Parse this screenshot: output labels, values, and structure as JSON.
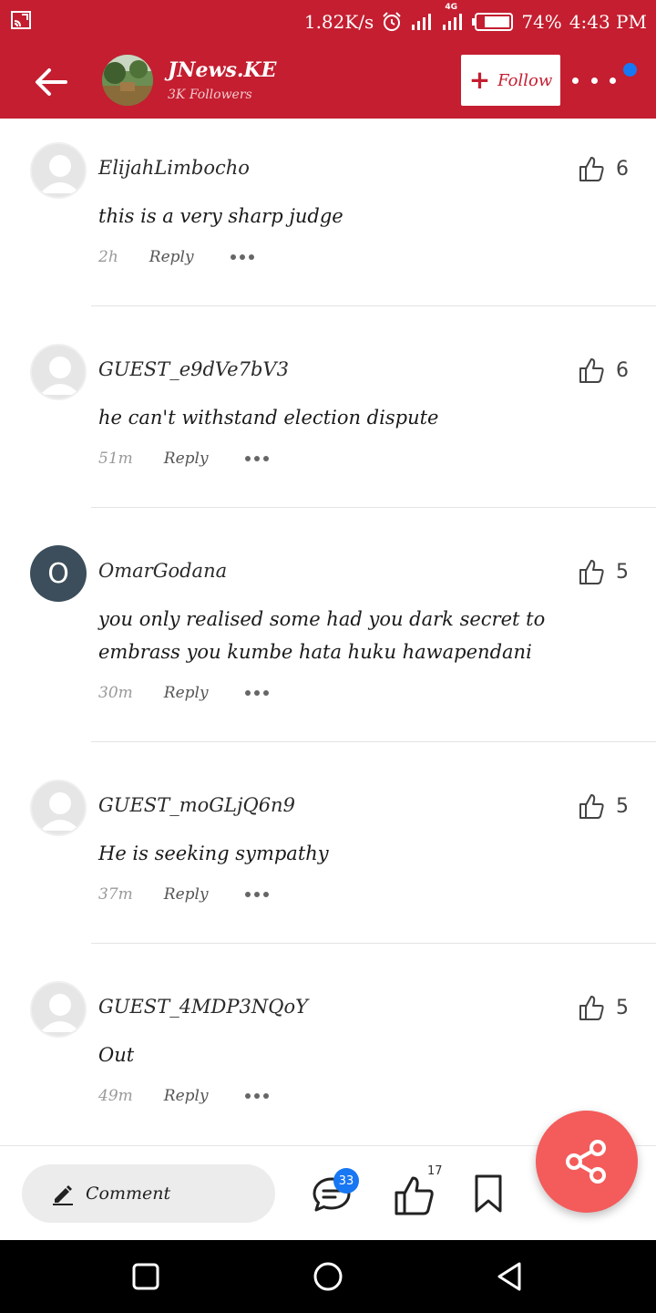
{
  "status_bar": {
    "network_speed": "1.82K/s",
    "network_type": "4G",
    "battery": "74%",
    "time": "4:43 PM"
  },
  "header": {
    "channel_name": "JNews.KE",
    "followers": "3K Followers",
    "follow_label": "Follow"
  },
  "comments": [
    {
      "username": "ElijahLimbocho",
      "avatar": "generic",
      "likes": "6",
      "text": "this is a very sharp judge",
      "time": "2h",
      "reply_label": "Reply"
    },
    {
      "username": "GUEST_e9dVe7bV3",
      "avatar": "generic",
      "likes": "6",
      "text": "he can't withstand election dispute",
      "time": "51m",
      "reply_label": "Reply"
    },
    {
      "username": "OmarGodana",
      "avatar": "O",
      "likes": "5",
      "text": "you only realised some had you dark secret to embrass you kumbe hata huku hawapendani",
      "time": "30m",
      "reply_label": "Reply"
    },
    {
      "username": "GUEST_moGLjQ6n9",
      "avatar": "generic",
      "likes": "5",
      "text": "He is seeking sympathy",
      "time": "37m",
      "reply_label": "Reply"
    },
    {
      "username": "GUEST_4MDP3NQoY",
      "avatar": "generic",
      "likes": "5",
      "text": "Out",
      "time": "49m",
      "reply_label": "Reply"
    }
  ],
  "bottom_bar": {
    "comment_placeholder": "Comment",
    "comment_count": "33",
    "like_count": "17"
  },
  "colors": {
    "brand_red": "#c41e30",
    "share_fab": "#f45b5b",
    "badge_blue": "#1877f2"
  },
  "icons": [
    "cast-icon",
    "alarm-icon",
    "signal-icon",
    "battery-icon",
    "back-arrow-icon",
    "plus-icon",
    "more-icon",
    "thumbs-up-icon",
    "pencil-icon",
    "chat-icon",
    "bookmark-icon",
    "share-icon",
    "recent-apps-icon",
    "home-icon",
    "back-icon"
  ]
}
